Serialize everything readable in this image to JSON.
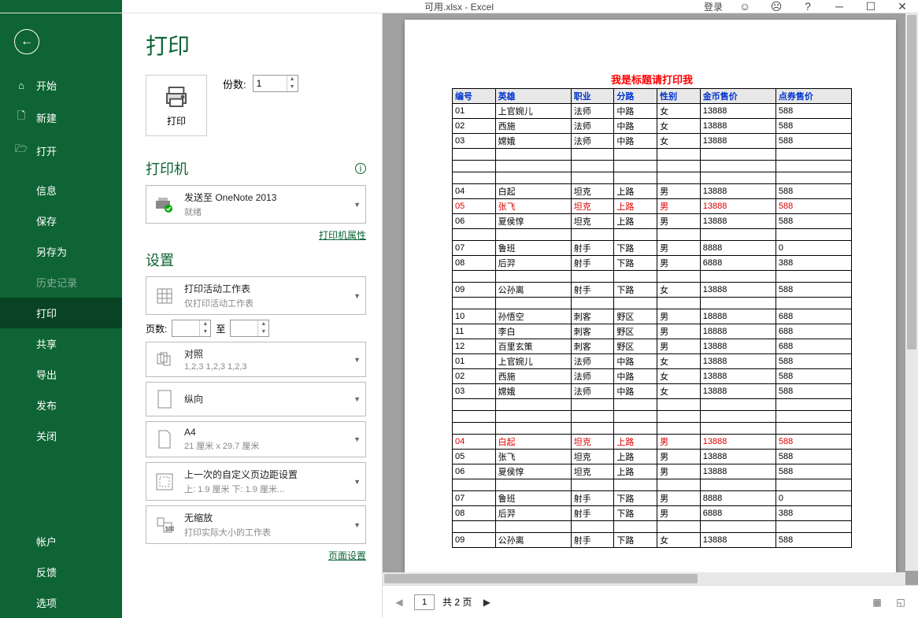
{
  "window": {
    "title": "可用.xlsx  -  Excel",
    "login": "登录"
  },
  "sidebar": {
    "items": [
      {
        "label": "开始"
      },
      {
        "label": "新建"
      },
      {
        "label": "打开"
      },
      {
        "label": "信息"
      },
      {
        "label": "保存"
      },
      {
        "label": "另存为"
      },
      {
        "label": "历史记录"
      },
      {
        "label": "打印"
      },
      {
        "label": "共享"
      },
      {
        "label": "导出"
      },
      {
        "label": "发布"
      },
      {
        "label": "关闭"
      }
    ],
    "bottom": [
      {
        "label": "帐户"
      },
      {
        "label": "反馈"
      },
      {
        "label": "选项"
      }
    ]
  },
  "print": {
    "title": "打印",
    "button_label": "打印",
    "copies_label": "份数:",
    "copies_value": "1",
    "printer_section": "打印机",
    "printer_name": "发送至 OneNote 2013",
    "printer_status": "就绪",
    "printer_props_link": "打印机属性",
    "settings_section": "设置",
    "pages_label": "页数:",
    "pages_to": "至",
    "page_setup_link": "页面设置",
    "settings": [
      {
        "line1": "打印活动工作表",
        "line2": "仅打印活动工作表"
      },
      {
        "line1": "对照",
        "line2": "1,2,3    1,2,3    1,2,3"
      },
      {
        "line1": "纵向",
        "line2": ""
      },
      {
        "line1": "A4",
        "line2": "21 厘米 x 29.7 厘米"
      },
      {
        "line1": "上一次的自定义页边距设置",
        "line2": "上: 1.9 厘米 下: 1.9 厘米..."
      },
      {
        "line1": "无缩放",
        "line2": "打印实际大小的工作表"
      }
    ]
  },
  "preview": {
    "sheet_title": "我是标题请打印我",
    "headers": [
      "编号",
      "英雄",
      "职业",
      "分路",
      "性别",
      "金币售价",
      "点券售价"
    ],
    "rows": [
      [
        "01",
        "上官婉儿",
        "法师",
        "中路",
        "女",
        "13888",
        "588"
      ],
      [
        "02",
        "西施",
        "法师",
        "中路",
        "女",
        "13888",
        "588"
      ],
      [
        "03",
        "嫦娥",
        "法师",
        "中路",
        "女",
        "13888",
        "588"
      ],
      [],
      [],
      [],
      [
        "04",
        "白起",
        "坦克",
        "上路",
        "男",
        "13888",
        "588"
      ],
      [
        "05",
        "张飞",
        "坦克",
        "上路",
        "男",
        "13888",
        "588"
      ],
      [
        "06",
        "夏侯惇",
        "坦克",
        "上路",
        "男",
        "13888",
        "588"
      ],
      [],
      [
        "07",
        "鲁班",
        "射手",
        "下路",
        "男",
        "8888",
        "0"
      ],
      [
        "08",
        "后羿",
        "射手",
        "下路",
        "男",
        "6888",
        "388"
      ],
      [],
      [
        "09",
        "公孙离",
        "射手",
        "下路",
        "女",
        "13888",
        "588"
      ],
      [],
      [
        "10",
        "孙悟空",
        "刺客",
        "野区",
        "男",
        "18888",
        "688"
      ],
      [
        "11",
        "李白",
        "刺客",
        "野区",
        "男",
        "18888",
        "688"
      ],
      [
        "12",
        "百里玄策",
        "刺客",
        "野区",
        "男",
        "13888",
        "688"
      ],
      [
        "01",
        "上官婉儿",
        "法师",
        "中路",
        "女",
        "13888",
        "588"
      ],
      [
        "02",
        "西施",
        "法师",
        "中路",
        "女",
        "13888",
        "588"
      ],
      [
        "03",
        "嫦娥",
        "法师",
        "中路",
        "女",
        "13888",
        "588"
      ],
      [],
      [],
      [],
      [
        "04",
        "白起",
        "坦克",
        "上路",
        "男",
        "13888",
        "588"
      ],
      [
        "05",
        "张飞",
        "坦克",
        "上路",
        "男",
        "13888",
        "588"
      ],
      [
        "06",
        "夏侯惇",
        "坦克",
        "上路",
        "男",
        "13888",
        "588"
      ],
      [],
      [
        "07",
        "鲁班",
        "射手",
        "下路",
        "男",
        "8888",
        "0"
      ],
      [
        "08",
        "后羿",
        "射手",
        "下路",
        "男",
        "6888",
        "388"
      ],
      [],
      [
        "09",
        "公孙离",
        "射手",
        "下路",
        "女",
        "13888",
        "588"
      ]
    ],
    "red_rows": [
      7,
      24
    ],
    "current_page": "1",
    "total_pages_label": "共 2 页"
  }
}
